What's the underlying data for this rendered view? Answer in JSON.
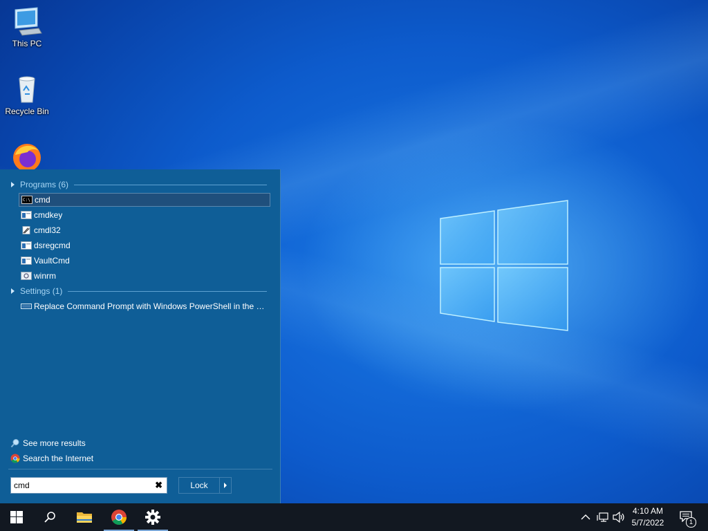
{
  "desktop": {
    "icons": [
      {
        "label": "This PC",
        "icon": "monitor-icon"
      },
      {
        "label": "Recycle Bin",
        "icon": "recycle-bin-icon"
      },
      {
        "label": "",
        "icon": "firefox-icon"
      }
    ]
  },
  "start_panel": {
    "programs_header": "Programs (6)",
    "programs": [
      {
        "label": "cmd",
        "icon": "console-icon",
        "selected": true
      },
      {
        "label": "cmdkey",
        "icon": "app-window-icon"
      },
      {
        "label": "cmdl32",
        "icon": "cmdl32-icon"
      },
      {
        "label": "dsregcmd",
        "icon": "app-window-icon"
      },
      {
        "label": "VaultCmd",
        "icon": "app-window-icon"
      },
      {
        "label": "winrm",
        "icon": "winrm-icon"
      }
    ],
    "settings_header": "Settings (1)",
    "settings": [
      {
        "label": "Replace Command Prompt with Windows PowerShell in the W...",
        "icon": "settings-display-icon"
      }
    ],
    "see_more": "See more results",
    "search_internet": "Search the Internet",
    "search_value": "cmd",
    "clear_symbol": "✖",
    "lock_label": "Lock"
  },
  "taskbar": {
    "items": [
      "start-icon",
      "search-icon",
      "file-explorer-icon",
      "chrome-icon",
      "settings-gear-icon"
    ],
    "clock_time": "4:10 AM",
    "clock_date": "5/7/2022",
    "notification_count": "1"
  },
  "colors": {
    "panel_bg": "#0f5e97",
    "selected_row": "#1f4f7c",
    "taskbar_bg": "#121821",
    "wallpaper": "#0a4fb8"
  }
}
